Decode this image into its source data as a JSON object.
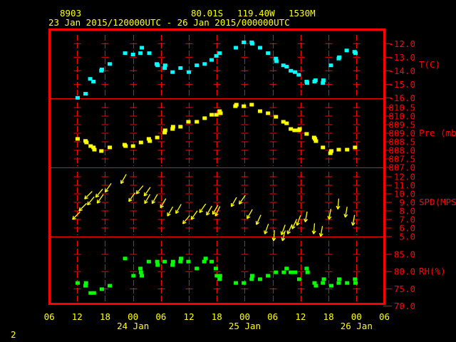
{
  "header": {
    "station_id": "8903",
    "latitude": "80.01S",
    "longitude": "119.40W",
    "elevation": "1530M",
    "time_range": "23 Jan 2015/120000UTC - 26 Jan 2015/000000UTC"
  },
  "footer": {
    "page_number": "2"
  },
  "colors": {
    "axis": "#ff0000",
    "text": "#ffff00",
    "temperature": "#00ffff",
    "pressure": "#ffff00",
    "wind": "#ffff00",
    "humidity": "#00ff00",
    "background": "#000000"
  },
  "chart_data": {
    "type": "scatter",
    "x_unit": "hours since 23 Jan 2015 06 UTC",
    "x_range": [
      0,
      72
    ],
    "x_ticks": [
      {
        "h": 0,
        "label": "06"
      },
      {
        "h": 6,
        "label": "12"
      },
      {
        "h": 12,
        "label": "18"
      },
      {
        "h": 18,
        "label": "00"
      },
      {
        "h": 24,
        "label": "06"
      },
      {
        "h": 30,
        "label": "12"
      },
      {
        "h": 36,
        "label": "18"
      },
      {
        "h": 42,
        "label": "00"
      },
      {
        "h": 48,
        "label": "06"
      },
      {
        "h": 54,
        "label": "12"
      },
      {
        "h": 60,
        "label": "18"
      },
      {
        "h": 66,
        "label": "00"
      },
      {
        "h": 72,
        "label": "06"
      }
    ],
    "date_labels": [
      {
        "h": 18,
        "label": "24 Jan"
      },
      {
        "h": 42,
        "label": "25 Jan"
      },
      {
        "h": 66,
        "label": "26 Jan"
      }
    ],
    "panels": [
      {
        "id": "temperature",
        "label": "T(C)",
        "ylim": [
          -16,
          -11.2
        ],
        "ticks": [
          "-12.0",
          "-13.0",
          "-14.0",
          "-15.0",
          "-16.0"
        ],
        "points": [
          [
            6.1,
            -16.0
          ],
          [
            7.8,
            -15.7
          ],
          [
            8.8,
            -14.6
          ],
          [
            9.5,
            -14.8
          ],
          [
            11.2,
            -14.0
          ],
          [
            11.3,
            -13.9
          ],
          [
            13.0,
            -13.5
          ],
          [
            16.3,
            -12.7
          ],
          [
            18.0,
            -12.8
          ],
          [
            19.6,
            -12.7
          ],
          [
            19.9,
            -12.3
          ],
          [
            21.5,
            -12.7
          ],
          [
            23.1,
            -13.5
          ],
          [
            23.3,
            -13.6
          ],
          [
            24.8,
            -13.8
          ],
          [
            24.9,
            -13.6
          ],
          [
            26.5,
            -14.1
          ],
          [
            28.2,
            -13.8
          ],
          [
            30.0,
            -14.1
          ],
          [
            31.7,
            -13.6
          ],
          [
            33.4,
            -13.5
          ],
          [
            34.9,
            -13.2
          ],
          [
            35.9,
            -12.9
          ],
          [
            36.6,
            -12.7
          ],
          [
            40.1,
            -12.3
          ],
          [
            41.8,
            -11.9
          ],
          [
            43.5,
            -11.9
          ],
          [
            43.6,
            -12.0
          ],
          [
            45.3,
            -12.3
          ],
          [
            47.0,
            -12.7
          ],
          [
            48.7,
            -13.1
          ],
          [
            48.8,
            -13.3
          ],
          [
            50.3,
            -13.6
          ],
          [
            51.0,
            -13.7
          ],
          [
            51.9,
            -14.0
          ],
          [
            52.8,
            -14.1
          ],
          [
            53.6,
            -14.3
          ],
          [
            55.3,
            -14.8
          ],
          [
            55.4,
            -14.9
          ],
          [
            57.0,
            -14.8
          ],
          [
            57.2,
            -14.7
          ],
          [
            58.8,
            -14.9
          ],
          [
            58.9,
            -14.7
          ],
          [
            60.5,
            -13.6
          ],
          [
            62.2,
            -13.1
          ],
          [
            62.3,
            -13.0
          ],
          [
            63.9,
            -12.5
          ],
          [
            65.6,
            -12.6
          ],
          [
            65.8,
            -12.7
          ]
        ]
      },
      {
        "id": "pressure",
        "label": "Pre (mb)",
        "ylim": [
          807.0,
          811.0
        ],
        "ticks": [
          "810.5",
          "810.0",
          "809.5",
          "809.0",
          "808.5",
          "808.0",
          "807.5",
          "807.0"
        ],
        "points": [
          [
            6.1,
            808.67
          ],
          [
            7.8,
            808.55
          ],
          [
            8.0,
            808.46
          ],
          [
            8.9,
            808.25
          ],
          [
            9.5,
            808.17
          ],
          [
            9.7,
            808.04
          ],
          [
            11.2,
            807.96
          ],
          [
            13.0,
            808.17
          ],
          [
            16.2,
            808.33
          ],
          [
            16.4,
            808.25
          ],
          [
            18.0,
            808.25
          ],
          [
            19.7,
            808.46
          ],
          [
            21.4,
            808.67
          ],
          [
            21.6,
            808.54
          ],
          [
            23.2,
            808.75
          ],
          [
            24.8,
            809.04
          ],
          [
            24.9,
            809.17
          ],
          [
            26.5,
            809.25
          ],
          [
            26.6,
            809.38
          ],
          [
            28.2,
            809.38
          ],
          [
            29.9,
            809.67
          ],
          [
            31.7,
            809.67
          ],
          [
            33.4,
            809.88
          ],
          [
            34.9,
            810.08
          ],
          [
            35.9,
            810.08
          ],
          [
            36.6,
            810.29
          ],
          [
            36.8,
            810.17
          ],
          [
            40.0,
            810.58
          ],
          [
            40.2,
            810.67
          ],
          [
            41.8,
            810.58
          ],
          [
            43.5,
            810.67
          ],
          [
            45.3,
            810.29
          ],
          [
            47.0,
            810.17
          ],
          [
            48.7,
            809.96
          ],
          [
            50.3,
            809.67
          ],
          [
            51.0,
            809.58
          ],
          [
            51.9,
            809.25
          ],
          [
            52.7,
            809.17
          ],
          [
            53.6,
            809.17
          ],
          [
            53.8,
            809.25
          ],
          [
            55.3,
            808.96
          ],
          [
            56.9,
            808.75
          ],
          [
            57.1,
            808.67
          ],
          [
            57.3,
            808.54
          ],
          [
            58.8,
            808.17
          ],
          [
            60.4,
            807.83
          ],
          [
            60.6,
            807.96
          ],
          [
            62.2,
            808.04
          ],
          [
            64.0,
            808.04
          ],
          [
            65.7,
            808.17
          ]
        ]
      },
      {
        "id": "wind",
        "label": "SPD(MPS)",
        "ylim": [
          5.0,
          13.0
        ],
        "ticks": [
          "12.0",
          "11.0",
          "10.0",
          "9.0",
          "8.0",
          "7.0",
          "6.0",
          "5.0"
        ],
        "points_format": "[hour, speed_mps, direction_from_deg]",
        "points": [
          [
            5.0,
            7.0,
            45
          ],
          [
            6.4,
            8.0,
            45
          ],
          [
            7.6,
            9.4,
            45
          ],
          [
            8.2,
            8.7,
            40
          ],
          [
            10.0,
            9.6,
            40
          ],
          [
            10.3,
            8.9,
            35
          ],
          [
            12.0,
            10.2,
            35
          ],
          [
            15.4,
            11.2,
            30
          ],
          [
            17.1,
            9.1,
            35
          ],
          [
            18.7,
            10.0,
            40
          ],
          [
            20.4,
            9.75,
            35
          ],
          [
            20.5,
            8.86,
            30
          ],
          [
            22.1,
            8.86,
            30
          ],
          [
            23.9,
            8.36,
            30
          ],
          [
            25.4,
            7.4,
            30
          ],
          [
            27.2,
            7.7,
            30
          ],
          [
            28.7,
            6.5,
            40
          ],
          [
            30.5,
            7.0,
            35
          ],
          [
            32.3,
            7.8,
            35
          ],
          [
            33.8,
            7.5,
            30
          ],
          [
            35.1,
            7.6,
            30
          ],
          [
            35.7,
            7.4,
            25
          ],
          [
            39.1,
            8.5,
            30
          ],
          [
            40.8,
            8.8,
            35
          ],
          [
            42.5,
            7.1,
            30
          ],
          [
            44.5,
            6.4,
            25
          ],
          [
            46.3,
            5.3,
            20
          ],
          [
            48.2,
            4.5,
            5
          ],
          [
            49.9,
            5.2,
            20
          ],
          [
            50.1,
            4.5,
            15
          ],
          [
            51.2,
            5.3,
            25
          ],
          [
            52.2,
            5.9,
            25
          ],
          [
            53.2,
            6.3,
            20
          ],
          [
            55.0,
            6.7,
            10
          ],
          [
            56.8,
            5.3,
            5
          ],
          [
            58.3,
            5.0,
            10
          ],
          [
            60.1,
            7.0,
            10
          ],
          [
            62.0,
            8.2,
            5
          ],
          [
            63.6,
            7.25,
            10
          ],
          [
            65.2,
            6.3,
            10
          ]
        ]
      },
      {
        "id": "humidity",
        "label": "RH(%)",
        "ylim": [
          70.0,
          87.0
        ],
        "ticks": [
          "85.0",
          "80.0",
          "75.0",
          "70.0"
        ],
        "points": [
          [
            6.1,
            76.7
          ],
          [
            7.8,
            75.9
          ],
          [
            7.9,
            76.7
          ],
          [
            8.9,
            73.8
          ],
          [
            9.6,
            73.8
          ],
          [
            11.3,
            74.9
          ],
          [
            13.0,
            75.9
          ],
          [
            16.3,
            83.8
          ],
          [
            18.1,
            78.8
          ],
          [
            19.6,
            80.9
          ],
          [
            19.7,
            79.8
          ],
          [
            19.9,
            78.8
          ],
          [
            21.4,
            82.9
          ],
          [
            23.2,
            82.9
          ],
          [
            23.3,
            81.9
          ],
          [
            24.8,
            82.9
          ],
          [
            26.5,
            81.9
          ],
          [
            26.6,
            82.9
          ],
          [
            28.2,
            82.9
          ],
          [
            28.3,
            83.8
          ],
          [
            29.9,
            82.9
          ],
          [
            31.7,
            80.9
          ],
          [
            33.3,
            82.9
          ],
          [
            33.6,
            83.8
          ],
          [
            34.9,
            82.9
          ],
          [
            35.8,
            80.9
          ],
          [
            36.0,
            78.8
          ],
          [
            36.6,
            77.8
          ],
          [
            36.7,
            78.8
          ],
          [
            40.1,
            76.7
          ],
          [
            41.8,
            76.7
          ],
          [
            43.5,
            77.8
          ],
          [
            43.6,
            78.8
          ],
          [
            45.3,
            77.8
          ],
          [
            47.0,
            78.8
          ],
          [
            48.7,
            79.8
          ],
          [
            50.4,
            79.8
          ],
          [
            51.0,
            80.9
          ],
          [
            51.9,
            79.8
          ],
          [
            52.8,
            79.8
          ],
          [
            53.7,
            77.8
          ],
          [
            55.3,
            80.9
          ],
          [
            55.5,
            79.8
          ],
          [
            57.0,
            76.7
          ],
          [
            57.3,
            75.9
          ],
          [
            58.8,
            76.7
          ],
          [
            59.0,
            77.8
          ],
          [
            60.6,
            75.9
          ],
          [
            62.2,
            76.7
          ],
          [
            62.3,
            77.8
          ],
          [
            64.0,
            76.7
          ],
          [
            65.7,
            77.8
          ],
          [
            65.8,
            76.7
          ]
        ]
      }
    ]
  }
}
